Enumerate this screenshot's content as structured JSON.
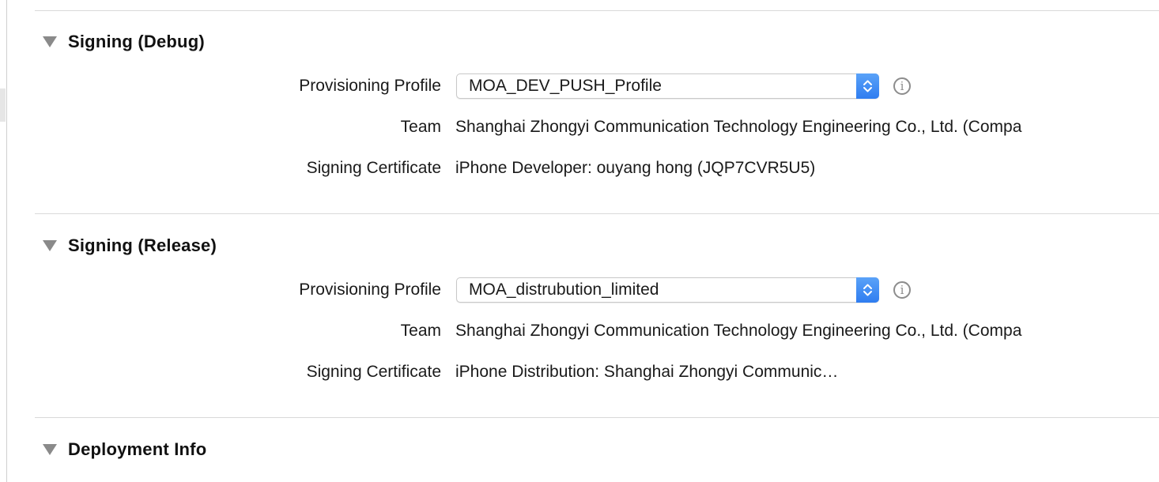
{
  "sections": [
    {
      "title": "Signing (Debug)",
      "provisioning_label": "Provisioning Profile",
      "provisioning_value": "MOA_DEV_PUSH_Profile",
      "team_label": "Team",
      "team_value": "Shanghai Zhongyi Communication Technology Engineering Co., Ltd. (Compa",
      "cert_label": "Signing Certificate",
      "cert_value": "iPhone Developer: ouyang hong (JQP7CVR5U5)"
    },
    {
      "title": "Signing (Release)",
      "provisioning_label": "Provisioning Profile",
      "provisioning_value": "MOA_distrubution_limited",
      "team_label": "Team",
      "team_value": "Shanghai Zhongyi Communication Technology Engineering Co., Ltd. (Compa",
      "cert_label": "Signing Certificate",
      "cert_value": "iPhone Distribution: Shanghai Zhongyi Communic…"
    },
    {
      "title": "Deployment Info"
    }
  ],
  "icons": {
    "disclosure": "disclosure-triangle-icon",
    "stepper": "up-down-chevron-icon",
    "info": "info-icon"
  },
  "colors": {
    "accent": "#3b86f5",
    "divider": "#d9d9d9"
  }
}
